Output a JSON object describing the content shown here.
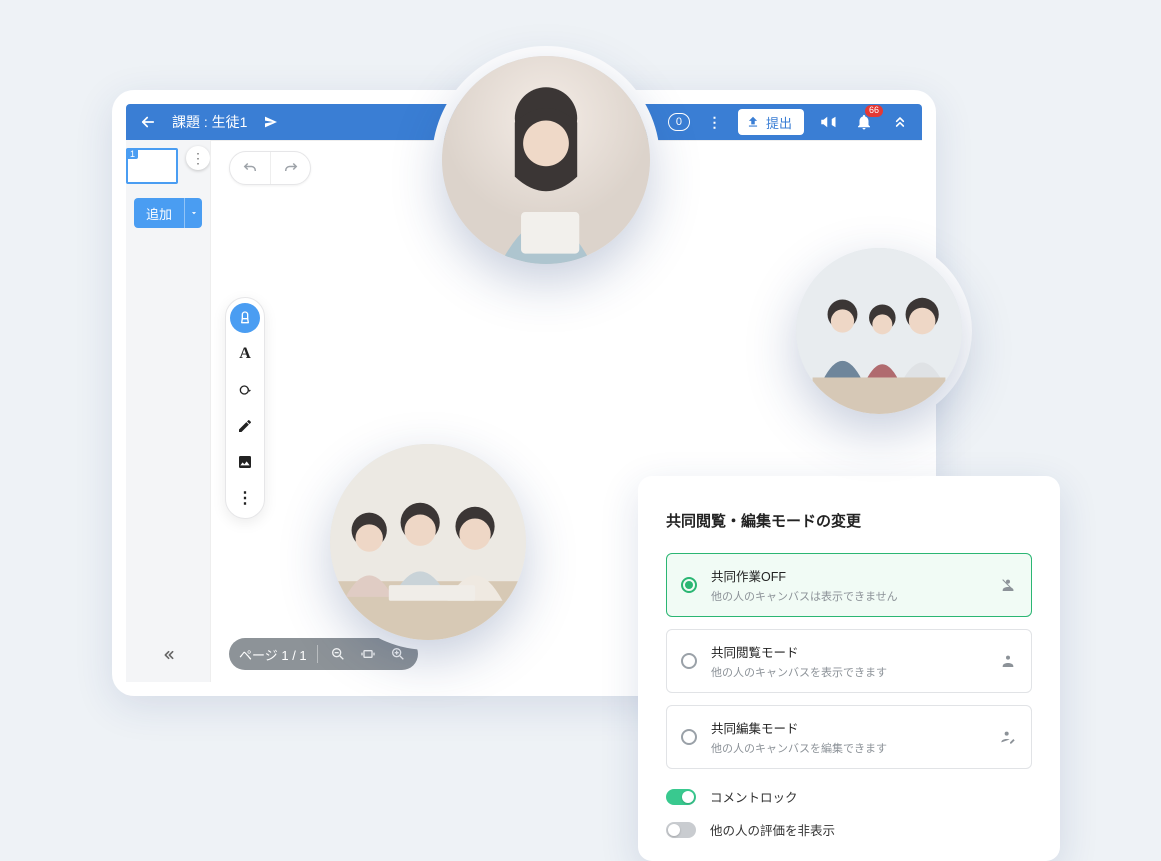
{
  "header": {
    "title": "課題 : 生徒1",
    "like_count": "0",
    "submit_label": "提出",
    "notification_count": "66"
  },
  "sidebar": {
    "page_number": "1",
    "add_label": "追加"
  },
  "footer": {
    "page_indicator": "ページ 1 / 1"
  },
  "modal": {
    "title": "共同閲覧・編集モードの変更",
    "options": [
      {
        "label": "共同作業OFF",
        "sub": "他の人のキャンバスは表示できません"
      },
      {
        "label": "共同閲覧モード",
        "sub": "他の人のキャンバスを表示できます"
      },
      {
        "label": "共同編集モード",
        "sub": "他の人のキャンバスを編集できます"
      }
    ],
    "toggle1": "コメントロック",
    "toggle2": "他の人の評価を非表示"
  }
}
